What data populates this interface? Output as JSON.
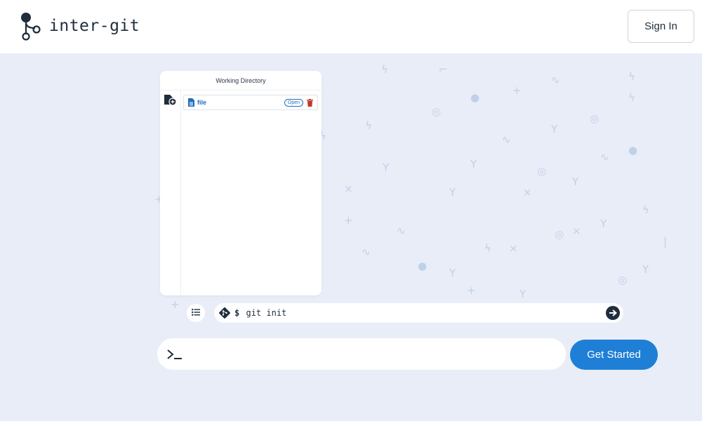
{
  "app": {
    "name": "inter-git"
  },
  "header": {
    "signin_label": "Sign In"
  },
  "working_directory": {
    "title": "Working Directory",
    "files": [
      {
        "name": "file",
        "open_label": "Open"
      }
    ]
  },
  "command_bar": {
    "prompt": "$",
    "command": "git init"
  },
  "terminal": {
    "placeholder": ""
  },
  "cta": {
    "label": "Get Started"
  },
  "colors": {
    "accent": "#1f7fd6",
    "background": "#e9edf7",
    "logo": "#1f2d3d",
    "delete": "#c0392b"
  },
  "icons": [
    "git-branch-logo-icon",
    "new-file-icon",
    "file-icon",
    "trash-icon",
    "list-icon",
    "git-icon",
    "arrow-right-icon",
    "terminal-prompt-icon"
  ]
}
